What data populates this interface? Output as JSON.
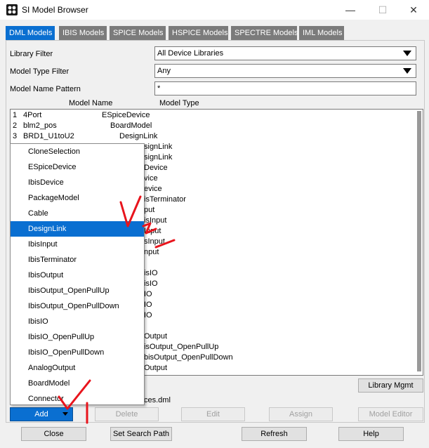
{
  "window": {
    "title": "SI Model Browser",
    "minimize_glyph": "—",
    "maximize_glyph": "☐",
    "close_glyph": "✕"
  },
  "tabs": [
    {
      "label": "DML Models",
      "active": true
    },
    {
      "label": "IBIS Models",
      "active": false
    },
    {
      "label": "SPICE Models",
      "active": false
    },
    {
      "label": "HSPICE Models",
      "active": false
    },
    {
      "label": "SPECTRE Models",
      "active": false
    },
    {
      "label": "IML Models",
      "active": false
    }
  ],
  "filters": {
    "library_label": "Library Filter",
    "library_value": "All Device Libraries",
    "type_label": "Model Type Filter",
    "type_value": "Any",
    "pattern_label": "Model Name Pattern",
    "pattern_value": "*"
  },
  "list": {
    "col_name": "Model Name",
    "col_type": "Model Type",
    "rows": [
      {
        "num": "1",
        "name": "4Port",
        "type": "ESpiceDevice"
      },
      {
        "num": "2",
        "name": "blm2_pos",
        "type": "BoardModel"
      },
      {
        "num": "3",
        "name": "BRD1_U1toU2",
        "type": "DesignLink"
      }
    ],
    "partial_types": [
      "signLink",
      "signLink",
      "Device",
      "vice",
      "evice",
      "isTerminator",
      "put",
      "isInput",
      "Input",
      "sInput",
      "nput",
      "",
      "isIO",
      "isIO",
      "IO",
      "IO",
      "IO",
      "",
      "Output",
      "isOutput_OpenPullUp",
      "bisOutput_OpenPullDown",
      "Output"
    ]
  },
  "dropdown": {
    "selected_index": 5,
    "items": [
      "CloneSelection",
      "ESpiceDevice",
      "IbisDevice",
      "PackageModel",
      "Cable",
      "DesignLink",
      "IbisInput",
      "IbisTerminator",
      "IbisOutput",
      "IbisOutput_OpenPullUp",
      "IbisOutput_OpenPullDown",
      "IbisIO",
      "IbisIO_OpenPullUp",
      "IbisIO_OpenPullDown",
      "AnalogOutput",
      "BoardModel",
      "Connector"
    ]
  },
  "partial_filename": "ces.dml",
  "buttons": {
    "library_mgmt": "Library Mgmt",
    "add": "Add",
    "delete": "Delete",
    "edit": "Edit",
    "assign": "Assign",
    "model_editor": "Model Editor",
    "close": "Close",
    "set_search_path": "Set Search Path",
    "refresh": "Refresh",
    "help": "Help"
  },
  "colors": {
    "accent": "#0a6fd1",
    "inactive_tab": "#7b7b7b",
    "annotation": "#e8141c"
  }
}
